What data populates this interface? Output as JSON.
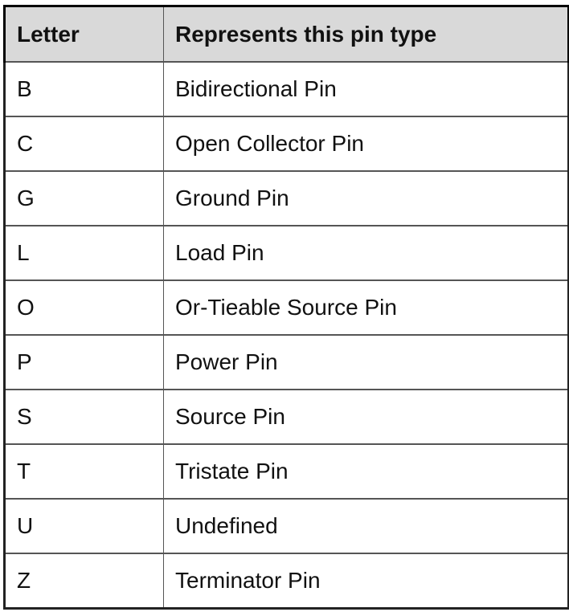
{
  "table": {
    "headers": [
      "Letter",
      "Represents this pin type"
    ],
    "rows": [
      {
        "letter": "B",
        "type": "Bidirectional Pin"
      },
      {
        "letter": "C",
        "type": "Open Collector Pin"
      },
      {
        "letter": "G",
        "type": "Ground Pin"
      },
      {
        "letter": "L",
        "type": "Load Pin"
      },
      {
        "letter": "O",
        "type": "Or-Tieable Source Pin"
      },
      {
        "letter": "P",
        "type": "Power Pin"
      },
      {
        "letter": "S",
        "type": "Source Pin"
      },
      {
        "letter": "T",
        "type": "Tristate Pin"
      },
      {
        "letter": "U",
        "type": "Undefined"
      },
      {
        "letter": "Z",
        "type": "Terminator Pin"
      }
    ]
  }
}
